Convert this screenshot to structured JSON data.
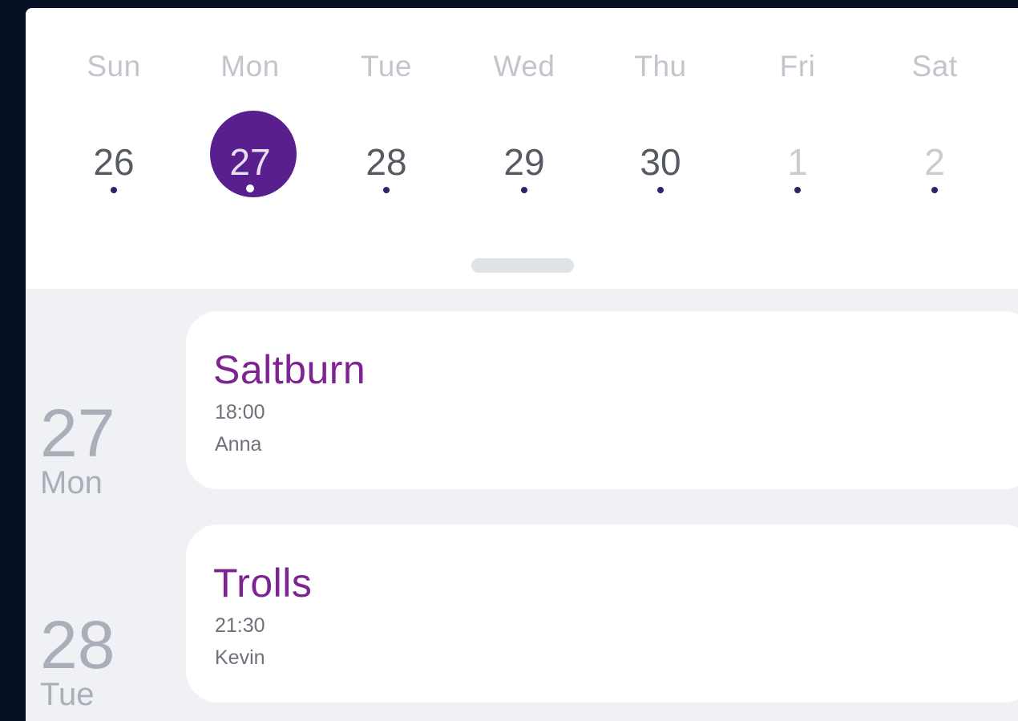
{
  "week": {
    "days": [
      {
        "name": "Sun",
        "date": "26"
      },
      {
        "name": "Mon",
        "date": "27"
      },
      {
        "name": "Tue",
        "date": "28"
      },
      {
        "name": "Wed",
        "date": "29"
      },
      {
        "name": "Thu",
        "date": "30"
      },
      {
        "name": "Fri",
        "date": "1"
      },
      {
        "name": "Sat",
        "date": "2"
      }
    ]
  },
  "agenda": {
    "days": [
      {
        "date": "27",
        "weekday": "Mon",
        "event": {
          "title": "Saltburn",
          "time": "18:00",
          "person": "Anna"
        }
      },
      {
        "date": "28",
        "weekday": "Tue",
        "event": {
          "title": "Trolls",
          "time": "21:30",
          "person": "Kevin"
        }
      }
    ]
  },
  "colors": {
    "background": "#061125",
    "accent": "#5a1f8f",
    "event_title": "#7d2392",
    "agenda_background": "#eff1f4"
  },
  "icons": [
    "event-dot-icon",
    "drag-handle-icon"
  ]
}
